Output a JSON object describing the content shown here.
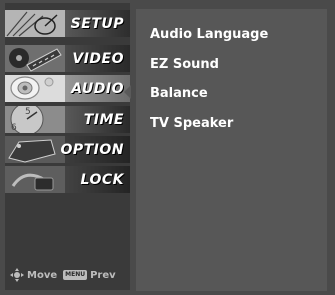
{
  "menu": {
    "tabs": [
      {
        "label": "SETUP",
        "icon": "satellite-dish-icon"
      },
      {
        "label": "VIDEO",
        "icon": "film-reel-icon"
      },
      {
        "label": "AUDIO",
        "icon": "speaker-icon"
      },
      {
        "label": "TIME",
        "icon": "clock-icon"
      },
      {
        "label": "OPTION",
        "icon": "option-tag-icon"
      },
      {
        "label": "LOCK",
        "icon": "lock-icon"
      }
    ],
    "selected": "AUDIO"
  },
  "footer": {
    "move_label": "Move",
    "menu_key_label": "MENU",
    "prev_label": "Prev"
  },
  "content": {
    "items": [
      "Audio Language",
      "EZ Sound",
      "Balance",
      "TV Speaker"
    ]
  },
  "colors": {
    "frame": "#4a4a4a",
    "sidebar": "#3a3a3a",
    "content_panel": "#575757",
    "text": "#ffffff",
    "footer_text": "#bcbcbc"
  }
}
